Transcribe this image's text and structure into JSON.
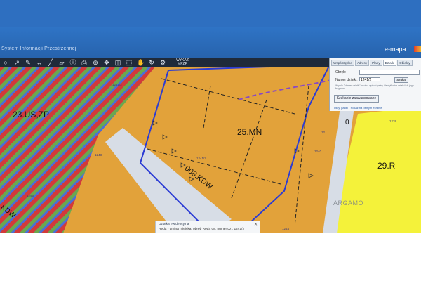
{
  "header": {
    "app_title": "System Informacji Przestrzennej",
    "logo": "e-mapa"
  },
  "toolbar": {
    "tools": [
      "circle-icon",
      "arrow-icon",
      "pen-icon",
      "measure-icon",
      "line-icon",
      "area-icon",
      "info-icon",
      "print-icon",
      "zoom-icon",
      "pan-icon",
      "layers-icon",
      "select-icon",
      "hand-icon",
      "refresh-icon",
      "gear-icon"
    ],
    "wypis_label": "WYKAZ MPZP"
  },
  "panel": {
    "tabs": [
      "Współrzędne",
      "Adresy",
      "Plany",
      "Działki",
      "Obiekty"
    ],
    "active_tab": "Działki",
    "obreb_label": "Obręb:",
    "obreb_value": "-",
    "numer_label": "Numer działki:",
    "numer_value": "1241/2",
    "search_button": "Szukaj",
    "hint": "W polu \"Numer działki\" można wpisać pełny identyfikator działki lub jego fragment",
    "advanced_button": "Szukanie zaawansowane",
    "links": "Ukryj panel · Pokaż na pełnym ekranie"
  },
  "map": {
    "labels": {
      "zone_us_zp": "23.US,ZP",
      "zone_mn": "25.MN",
      "zone_r": "29.R",
      "road_kdw": "008.KDW",
      "road_left": "KDW",
      "road_right": "0"
    },
    "parcels": [
      "1241/2",
      "1243",
      "1241/2",
      "1240",
      "1239",
      "1245",
      "1244",
      "12"
    ],
    "colors": {
      "residential": "#e2a23a",
      "agricultural": "#f4f23a",
      "sport": "#d83a3a",
      "stripe": "#6aa84f",
      "road": "#d7dde6",
      "boundary": "#2b3bd4"
    }
  },
  "popup": {
    "title": "Działka ewidencyjna",
    "body": "Reda - gmina miejska, obręb Reda 08, numer dz.: 1241/2",
    "close": "✕"
  },
  "watermark": "ARGAMO"
}
